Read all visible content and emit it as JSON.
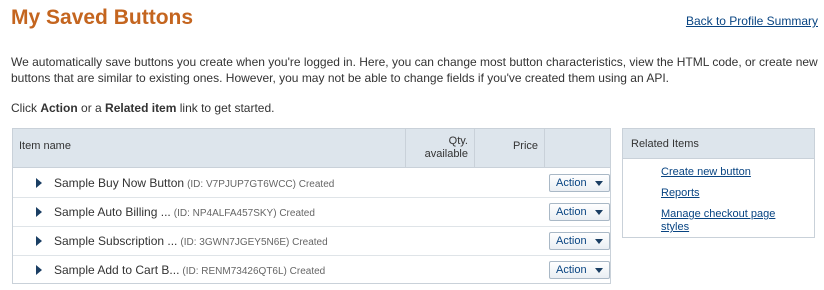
{
  "page": {
    "title": "My Saved Buttons",
    "back_link": "Back to Profile Summary",
    "intro": "We automatically save buttons you create when you're logged in. Here, you can change most button characteristics, view the HTML code, or create new buttons that are similar to existing ones. However, you may not be able to change fields if you've created them using an API.",
    "prompt_pre": "Click ",
    "prompt_action": "Action",
    "prompt_mid": " or a ",
    "prompt_related": "Related item",
    "prompt_post": " link to get started."
  },
  "table": {
    "headers": {
      "item_name": "Item name",
      "qty": "Qty. available",
      "price": "Price"
    },
    "rows": [
      {
        "name": "Sample Buy Now Button",
        "meta": "(ID: V7PJUP7GT6WCC) Created",
        "action": "Action"
      },
      {
        "name": "Sample Auto Billing ...",
        "meta": "(ID: NP4ALFA457SKY) Created",
        "action": "Action"
      },
      {
        "name": "Sample Subscription ...",
        "meta": "(ID: 3GWN7JGEY5N6E) Created",
        "action": "Action"
      },
      {
        "name": "Sample Add to Cart B...",
        "meta": "(ID: RENM73426QT6L) Created",
        "action": "Action"
      }
    ]
  },
  "related": {
    "header": "Related Items",
    "links": [
      "Create new button",
      "Reports",
      "Manage checkout page styles"
    ]
  },
  "colors": {
    "title": "#c4651f",
    "link": "#084482",
    "header_bg": "#dde5ec"
  }
}
